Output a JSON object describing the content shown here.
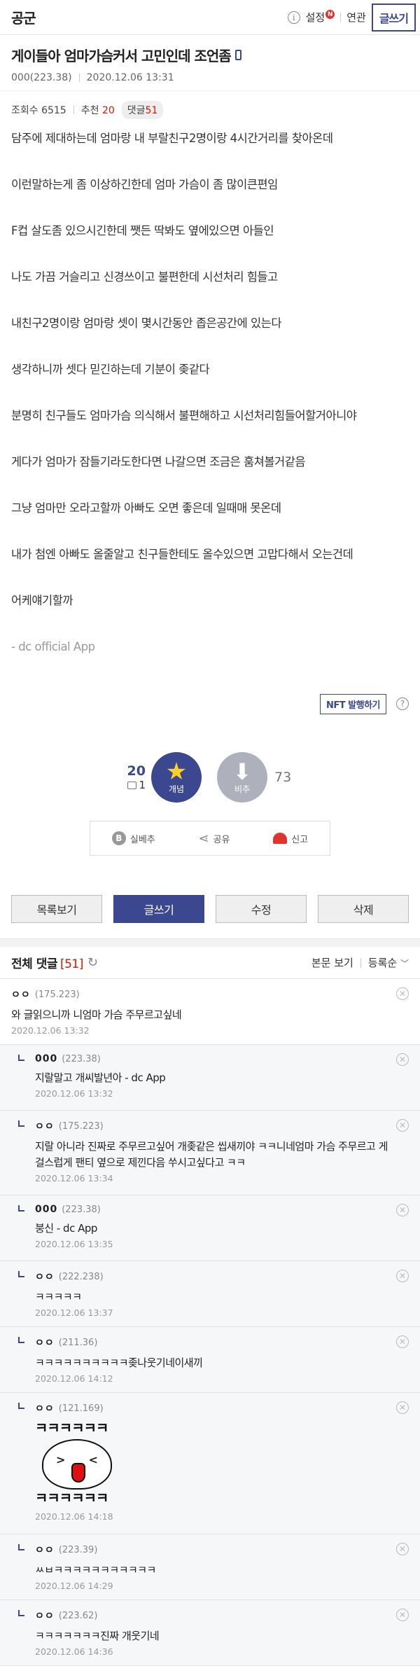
{
  "header": {
    "gallery_name": "공군",
    "info_symbol": "i",
    "settings_label": "설정",
    "settings_badge": "N",
    "related_label": "연관",
    "write_label": "글쓰기"
  },
  "post": {
    "title": "게이들아 엄마가슴커서 고민인데 조언좀",
    "author": "000(223.38)",
    "date": "2020.12.06 13:31",
    "views_label": "조회수 6515",
    "recommend_label": "추천",
    "recommend_count": "20",
    "reply_label": "댓글",
    "reply_count": "51",
    "body": [
      "담주에 제대하는데 엄마랑 내 부랄친구2명이랑 4시간거리를 찾아온데",
      "이런말하는게 좀 이상하긴한데 엄마 가슴이 좀 많이큰편임",
      "F컵 살도좀 있으시긴한데 쨋든 딱봐도 옆에있으면 아들인",
      "나도 가끔 거슬리고 신경쓰이고 불편한데 시선처리 힘들고",
      "내친구2명이랑 엄마랑 셋이 몇시간동안 좁은공간에 있는다",
      "생각하니까 셋다 믿긴하는데 기분이 좆같다",
      "분명히 친구들도 엄마가슴 의식해서 불편해하고 시선처리힘들어할거아니야",
      "게다가 엄마가 잠들기라도한다면 나갈으면 조금은 훔쳐볼거같음",
      "그냥 엄마만 오라고할까 아빠도 오면 좋은데 일때매 못온데",
      "내가 첨엔 아빠도 올줄알고 친구들한테도 올수있으면 고맙다해서 오는건데",
      "어케얘기할까"
    ],
    "app_signature": "- dc official App",
    "nft_button": "NFT 발행하기",
    "help_symbol": "?"
  },
  "vote": {
    "up_count": "20",
    "fixed_count": "1",
    "up_label": "개념",
    "down_label": "비추",
    "down_count": "73"
  },
  "share": {
    "best_label": "실베추",
    "share_label": "공유",
    "report_label": "신고"
  },
  "actions": {
    "list_label": "목록보기",
    "write_label": "글쓰기",
    "edit_label": "수정",
    "delete_label": "삭제"
  },
  "comments_header": {
    "title": "전체 댓글",
    "count": "[51]",
    "body_view": "본문 보기",
    "sort": "등록순"
  },
  "comments": [
    {
      "nick": "ㅇㅇ",
      "ip": "(175.223)",
      "text": "와 글읽으니까 니엄마 가슴 주무르고싶네",
      "date": "2020.12.06 13:32"
    },
    {
      "nick": "000",
      "ip": "(223.38)",
      "text": "지랄말고 개씨발년아 - dc App",
      "date": "2020.12.06 13:32"
    },
    {
      "nick": "ㅇㅇ",
      "ip": "(175.223)",
      "text": "지랄 아니라 진짜로 주무르고싶어 개좆같은 씹새끼야 ㅋㅋ니네엄마 가슴 주무르고 게걸스럽게 팬티 옆으로 제낀다음 쑤시고싶다고 ㅋㅋ",
      "date": "2020.12.06 13:34"
    },
    {
      "nick": "000",
      "ip": "(223.38)",
      "text": "붕신 - dc App",
      "date": "2020.12.06 13:35"
    },
    {
      "nick": "ㅇㅇ",
      "ip": "(222.238)",
      "text": "ㅋㅋㅋㅋㅋ",
      "date": "2020.12.06 13:37"
    },
    {
      "nick": "ㅇㅇ",
      "ip": "(211.36)",
      "text": "ㅋㅋㅋㅋㅋㅋㅋㅋㅋㅋ좆나웃기네이새끼",
      "date": "2020.12.06 14:12"
    },
    {
      "nick": "ㅇㅇ",
      "ip": "(121.169)",
      "text": "",
      "dccon_text": "ㅋㅋㅋㅋㅋㅋ",
      "date": "2020.12.06 14:18"
    },
    {
      "nick": "ㅇㅇ",
      "ip": "(223.39)",
      "text": "ㅆㅂㅋㅋㅋㅋㅋㅋㅋㅋㅋㅋㅋ",
      "date": "2020.12.06 14:29"
    },
    {
      "nick": "ㅇㅇ",
      "ip": "(223.62)",
      "text": "ㅋㅋㅋㅋㅋㅋㅋ진짜 개웃기네",
      "date": "2020.12.06 14:36"
    }
  ],
  "icons": {
    "comment_close": "x-circle-icon",
    "refresh": "refresh-icon",
    "reply": "reply-arrow-icon"
  },
  "colors": {
    "brand": "#3b4890",
    "accent_red": "#d31900",
    "star": "#ffd02a"
  }
}
